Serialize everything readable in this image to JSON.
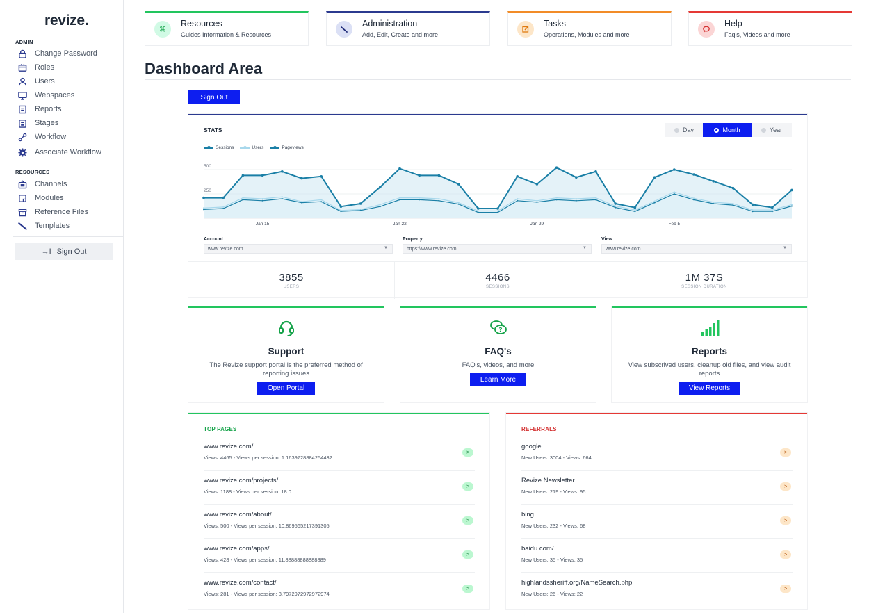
{
  "sidebar": {
    "logo": "revize.",
    "admin_label": "ADMIN",
    "admin_items": [
      {
        "label": "Change Password",
        "icon": "lock-icon"
      },
      {
        "label": "Roles",
        "icon": "roles-icon"
      },
      {
        "label": "Users",
        "icon": "user-icon"
      },
      {
        "label": "Webspaces",
        "icon": "monitor-icon"
      },
      {
        "label": "Reports",
        "icon": "reports-icon"
      },
      {
        "label": "Stages",
        "icon": "stages-icon"
      },
      {
        "label": "Workflow",
        "icon": "workflow-icon"
      },
      {
        "label": "Associate Workflow",
        "icon": "gear-icon"
      }
    ],
    "resources_label": "RESOURCES",
    "resource_items": [
      {
        "label": "Channels",
        "icon": "channels-icon"
      },
      {
        "label": "Modules",
        "icon": "modules-icon"
      },
      {
        "label": "Reference Files",
        "icon": "folder-icon"
      },
      {
        "label": "Templates",
        "icon": "pen-icon"
      }
    ],
    "signout_label": "Sign Out",
    "accent": "#2b3a8f"
  },
  "top_cards": [
    {
      "title": "Resources",
      "subtitle": "Guides Information & Resources",
      "color": "#22c55e",
      "bg": "#d1fae5",
      "icon": "command-icon"
    },
    {
      "title": "Administration",
      "subtitle": "Add, Edit, Create and more",
      "color": "#2b3a8f",
      "bg": "#dbe0f5",
      "icon": "wand-icon"
    },
    {
      "title": "Tasks",
      "subtitle": "Operations, Modules and more",
      "color": "#f28c28",
      "bg": "#fde6c8",
      "icon": "edit-icon"
    },
    {
      "title": "Help",
      "subtitle": "Faq's, Videos and more",
      "color": "#e53935",
      "bg": "#fbd5d5",
      "icon": "chat-icon"
    }
  ],
  "dashboard": {
    "title": "Dashboard Area",
    "signout_label": "Sign Out"
  },
  "stats": {
    "title": "STATS",
    "ranges": [
      "Day",
      "Month",
      "Year"
    ],
    "selected_range": "Month",
    "selects": [
      {
        "label": "Account",
        "value": "www.revize.com"
      },
      {
        "label": "Property",
        "value": "https://www.revize.com"
      },
      {
        "label": "View",
        "value": "www.revize.com"
      }
    ],
    "kpis": [
      {
        "value": "3855",
        "label": "USERS"
      },
      {
        "value": "4466",
        "label": "SESSIONS"
      },
      {
        "value": "1M 37S",
        "label": "SESSION DURATION"
      }
    ]
  },
  "chart_data": {
    "type": "area",
    "legend": [
      "Sessions",
      "Users",
      "Pageviews"
    ],
    "legend_placement": "top-left",
    "ylim": [
      0,
      600
    ],
    "y_ticks": [
      "500",
      "250"
    ],
    "x_ticks": [
      {
        "index": 3,
        "label": "Jan 15"
      },
      {
        "index": 10,
        "label": "Jan 22"
      },
      {
        "index": 17,
        "label": "Jan 29"
      },
      {
        "index": 24,
        "label": "Feb 5"
      }
    ],
    "series": [
      {
        "name": "Sessions",
        "color": "#1a7fa6",
        "fill": "#cde8f3",
        "values": [
          210,
          210,
          440,
          440,
          480,
          410,
          430,
          120,
          150,
          320,
          510,
          440,
          440,
          350,
          100,
          100,
          430,
          350,
          520,
          420,
          480,
          150,
          110,
          420,
          500,
          450,
          380,
          310,
          140,
          110,
          290
        ]
      },
      {
        "name": "Users",
        "color": "#a8d8ec",
        "fill": "#dff0f8",
        "values": [
          105,
          115,
          210,
          200,
          220,
          170,
          190,
          80,
          90,
          140,
          210,
          210,
          200,
          160,
          75,
          75,
          200,
          180,
          210,
          200,
          210,
          125,
          85,
          175,
          270,
          205,
          165,
          150,
          85,
          85,
          140
        ]
      },
      {
        "name": "Pageviews",
        "color": "#1a7fa6",
        "fill": "none",
        "values": [
          90,
          100,
          190,
          180,
          200,
          160,
          170,
          70,
          80,
          120,
          190,
          190,
          180,
          145,
          60,
          60,
          180,
          165,
          190,
          180,
          190,
          110,
          70,
          160,
          250,
          190,
          150,
          135,
          70,
          70,
          125
        ]
      }
    ]
  },
  "features": [
    {
      "title": "Support",
      "desc": "The Revize support portal is the preferred method of reporting issues",
      "button": "Open Portal",
      "icon": "headset-icon"
    },
    {
      "title": "FAQ's",
      "desc": "FAQ's, videos, and more",
      "button": "Learn More",
      "icon": "faq-icon"
    },
    {
      "title": "Reports",
      "desc": "View subscrived users, cleanup old files, and view audit reports",
      "button": "View Reports",
      "icon": "bar-chart-icon"
    }
  ],
  "top_pages": {
    "title": "TOP PAGES",
    "color": "#22c55e",
    "rows": [
      {
        "url": "www.revize.com/",
        "stats": "Views: 4465 - Views per session: 1.1639728884254432"
      },
      {
        "url": "www.revize.com/projects/",
        "stats": "Views: 1188 - Views per session: 18.0"
      },
      {
        "url": "www.revize.com/about/",
        "stats": "Views: 500 - Views per session: 10.869565217391305"
      },
      {
        "url": "www.revize.com/apps/",
        "stats": "Views: 428 - Views per session: 11.88888888888889"
      },
      {
        "url": "www.revize.com/contact/",
        "stats": "Views: 281 - Views per session: 3.7972972972972974"
      }
    ]
  },
  "referrals": {
    "title": "REFERRALS",
    "color": "#e53935",
    "rows": [
      {
        "source": "google",
        "stats": "New Users: 3004 - Views: 664"
      },
      {
        "source": "Revize Newsletter",
        "stats": "New Users: 219 - Views: 95"
      },
      {
        "source": "bing",
        "stats": "New Users: 232 - Views: 68"
      },
      {
        "source": "baidu.com/",
        "stats": "New Users: 35 - Views: 35"
      },
      {
        "source": "highlandssheriff.org/NameSearch.php",
        "stats": "New Users: 26 - Views: 22"
      }
    ]
  },
  "arrow_glyph": ">"
}
